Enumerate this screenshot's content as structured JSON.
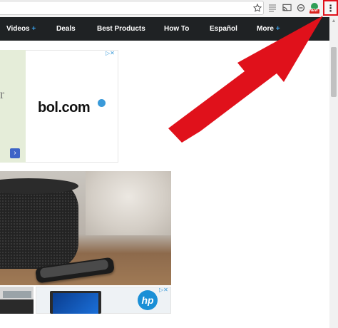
{
  "toolbar": {
    "icons": [
      "star-icon",
      "reader-mode-icon",
      "cast-icon",
      "sync-icon",
      "extension-icon",
      "menu-icon"
    ],
    "extension_badge": "NEW",
    "menu_glyph": "⋮"
  },
  "nav": {
    "items": [
      {
        "label": "Videos",
        "plus": "+"
      },
      {
        "label": "Deals"
      },
      {
        "label": "Best Products"
      },
      {
        "label": "How To"
      },
      {
        "label": "Español"
      },
      {
        "label": "More",
        "plus": "+"
      }
    ]
  },
  "ads": {
    "top": {
      "logo_text": "bol.com",
      "partial_letter": "r",
      "cta_glyph": "›",
      "adchoices": "▷✕"
    },
    "bottom": {
      "logo_text": "hp",
      "adchoices": "▷✕"
    }
  },
  "colors": {
    "nav_bg": "#1f2224",
    "accent_plus": "#3aa0e8",
    "annotation_red": "#e0111b"
  }
}
